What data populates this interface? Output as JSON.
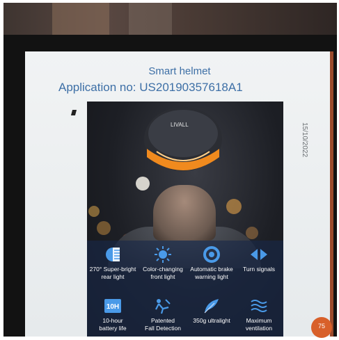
{
  "slide": {
    "title": "Smart helmet",
    "application_no": "Application no: US20190357618A1",
    "date": "15/10/2022",
    "page_number": "75"
  },
  "product": {
    "brand": "LIVALL",
    "features": [
      {
        "icon": "half-circle-light-icon",
        "label_line1": "270° Super-bright",
        "label_line2": "rear light"
      },
      {
        "icon": "sun-icon",
        "label_line1": "Color-changing",
        "label_line2": "front light"
      },
      {
        "icon": "brake-ring-icon",
        "label_line1": "Automatic brake",
        "label_line2": "warning light"
      },
      {
        "icon": "double-arrow-icon",
        "label_line1": "Turn signals",
        "label_line2": ""
      },
      {
        "icon": "10h-battery-icon",
        "icon_text": "10H",
        "label_line1": "10-hour",
        "label_line2": "battery life"
      },
      {
        "icon": "fall-detection-icon",
        "label_line1": "Patented",
        "label_line2": "Fall Detection"
      },
      {
        "icon": "feather-icon",
        "label_line1": "350g ultralight",
        "label_line2": ""
      },
      {
        "icon": "wind-waves-icon",
        "label_line1": "Maximum",
        "label_line2": "ventilation"
      }
    ]
  },
  "colors": {
    "title_blue": "#3d6fa6",
    "helmet_light": "#f08a1e",
    "badge_orange": "#d8602a",
    "icon_blue": "#4a9ae8"
  }
}
